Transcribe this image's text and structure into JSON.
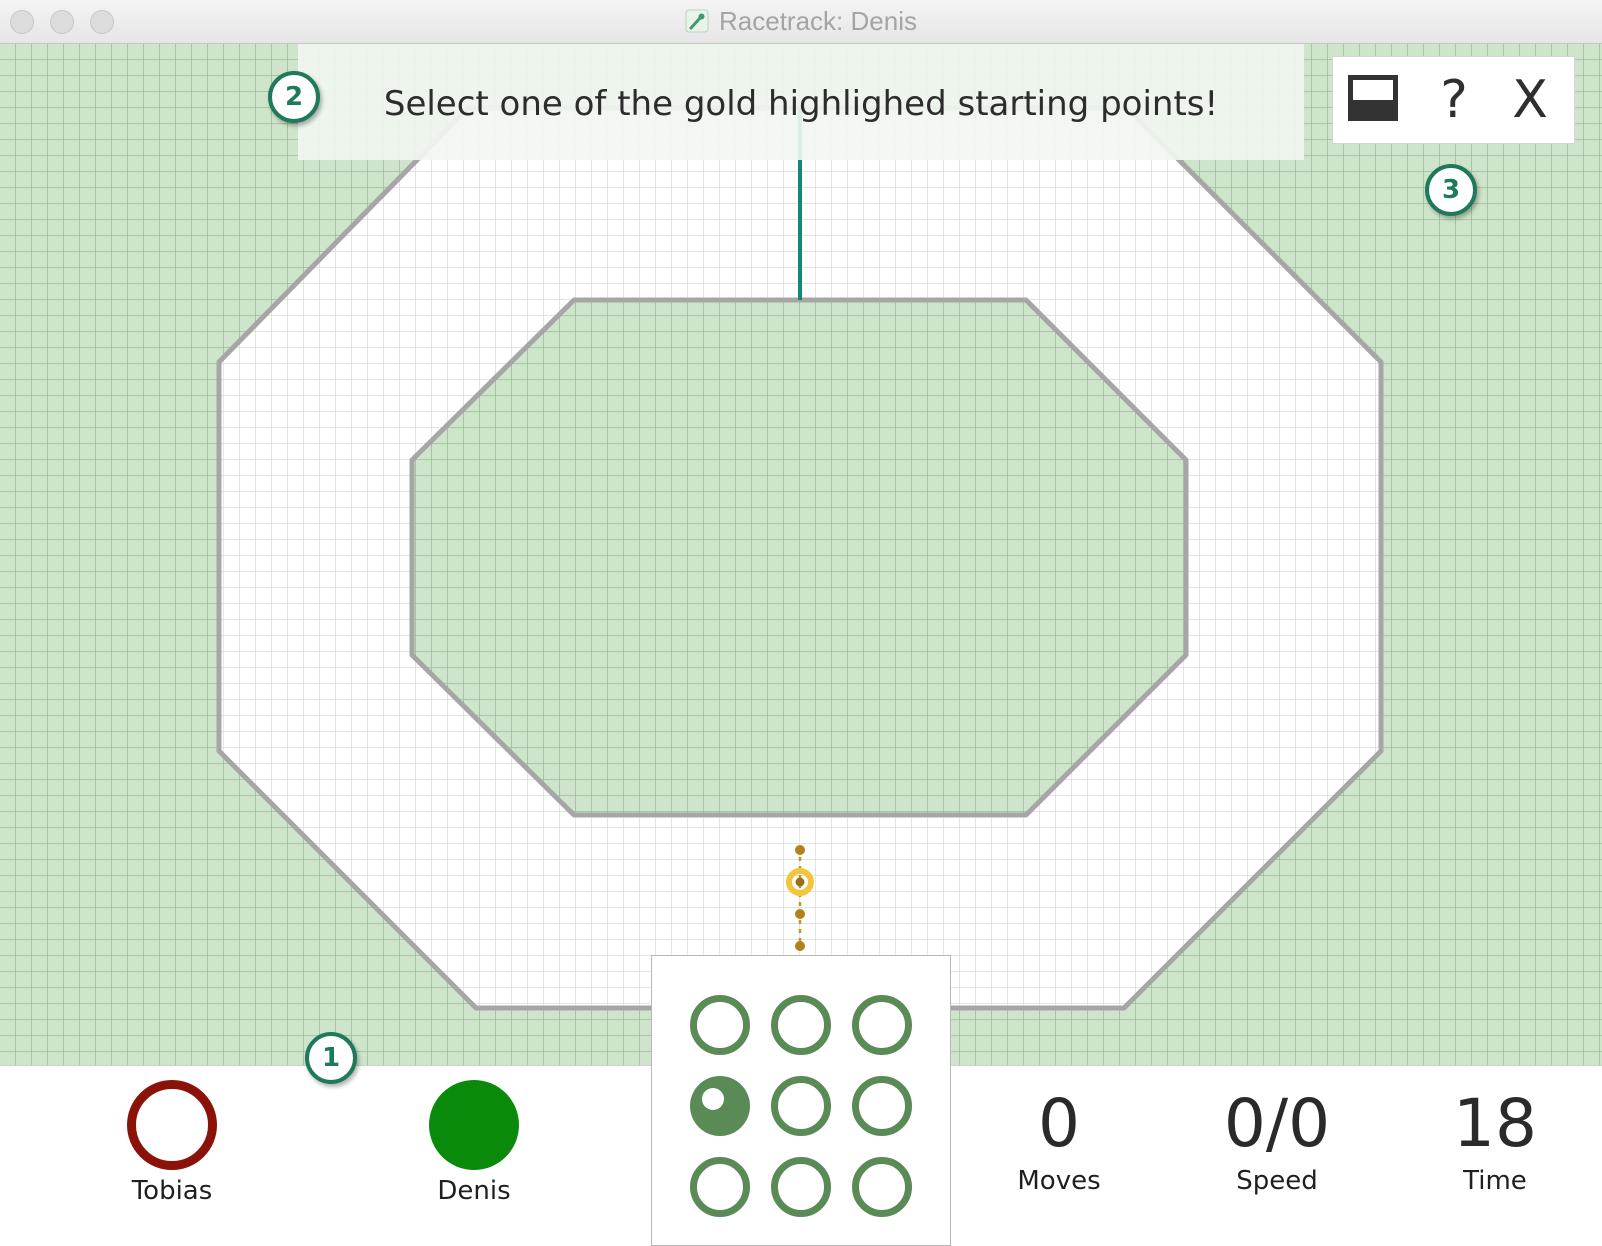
{
  "window": {
    "title": "Racetrack: Denis",
    "title_icon": "racetrack-app-icon"
  },
  "message": {
    "text": "Select one of the gold highlighed starting points!"
  },
  "toolbar": {
    "panel_icon": "panel-toggle-icon",
    "help_label": "?",
    "close_label": "X"
  },
  "callouts": [
    "1",
    "2",
    "3"
  ],
  "players": [
    {
      "name": "Tobias",
      "color": "#8b1208",
      "icon": "hollow-circle-icon"
    },
    {
      "name": "Denis",
      "color": "#0a8a0a",
      "icon": "filled-circle-icon"
    }
  ],
  "stats": [
    {
      "value": "0",
      "label": "Moves"
    },
    {
      "value": "0/0",
      "label": "Speed"
    },
    {
      "value": "18",
      "label": "Time"
    }
  ],
  "dpad": {
    "selected_index": 3,
    "option_count": 9
  },
  "colors": {
    "grass": "#cfe5cb",
    "track": "#ffffff",
    "border": "#a6a6a6",
    "finish_line": "#14867a",
    "start_points": "#c8941c",
    "highlight": "#f2c63c",
    "accent": "#1f7a5a",
    "dpad": "#5a8a55"
  }
}
